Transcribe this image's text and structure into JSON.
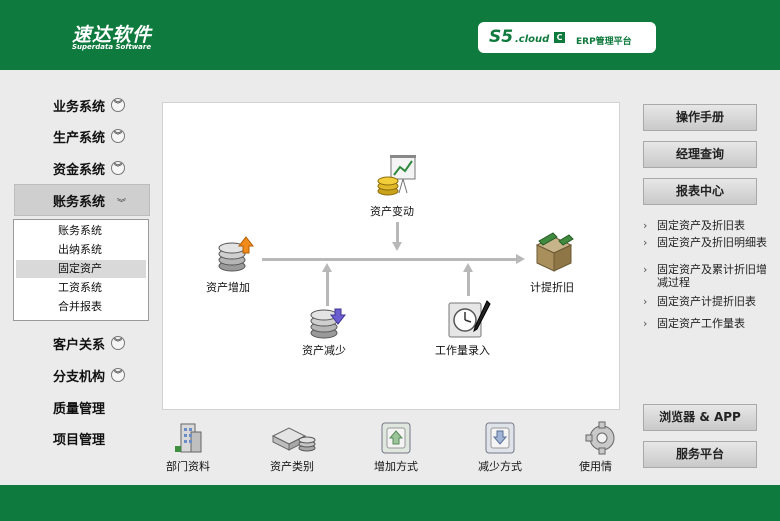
{
  "header": {
    "logo_main": "速达软件",
    "logo_sub": "Superdata Software",
    "badge_s5": "S5",
    "badge_cloud": ".cloud",
    "badge_c": "C",
    "badge_erp": "ERP管理平台"
  },
  "nav": {
    "items": [
      "业务系统",
      "生产系统",
      "资金系统",
      "账务系统",
      "客户关系",
      "分支机构",
      "质量管理",
      "项目管理"
    ],
    "active": "账务系统",
    "sub_items": [
      "账务系统",
      "出纳系统",
      "固定资产",
      "工资系统",
      "合并报表"
    ],
    "selected_sub": "固定资产"
  },
  "flow": {
    "change": "资产变动",
    "add": "资产增加",
    "depreciate": "计提折旧",
    "reduce": "资产减少",
    "workload": "工作量录入"
  },
  "bottom": [
    "部门资料",
    "资产类别",
    "增加方式",
    "减少方式",
    "使用情"
  ],
  "right": {
    "buttons_top": [
      "操作手册",
      "经理查询",
      "报表中心"
    ],
    "reports": [
      "固定资产及折旧表",
      "固定资产及折旧明细表",
      "固定资产及累计折旧增减过程",
      "固定资产计提折旧表",
      "固定资产工作量表"
    ],
    "buttons_bottom": [
      "浏览器 & APP",
      "服务平台"
    ]
  },
  "colors": {
    "brand_green": "#0f7a3d",
    "panel_bg": "#ffffff",
    "page_bg": "#ebebeb"
  }
}
